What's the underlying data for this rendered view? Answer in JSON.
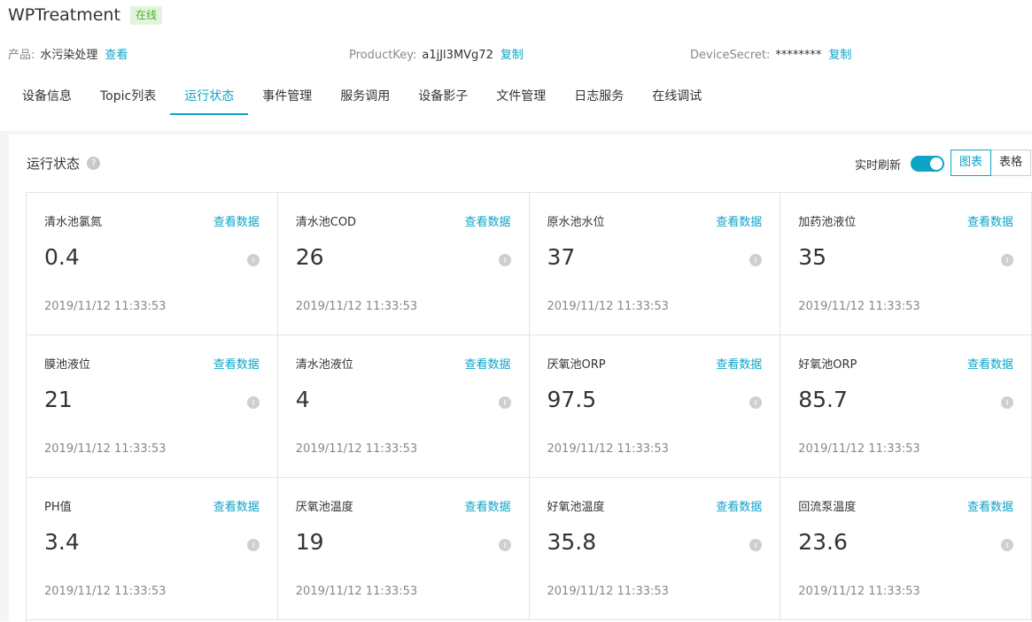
{
  "device": {
    "name": "WPTreatment",
    "status": "在线"
  },
  "meta": {
    "product_label": "产品:",
    "product_value": "水污染处理",
    "product_link": "查看",
    "productkey_label": "ProductKey:",
    "productkey_value": "a1jJl3MVg72",
    "productkey_copy": "复制",
    "secret_label": "DeviceSecret:",
    "secret_value": "********",
    "secret_copy": "复制"
  },
  "tabs": [
    {
      "label": "设备信息",
      "active": false
    },
    {
      "label": "Topic列表",
      "active": false
    },
    {
      "label": "运行状态",
      "active": true
    },
    {
      "label": "事件管理",
      "active": false
    },
    {
      "label": "服务调用",
      "active": false
    },
    {
      "label": "设备影子",
      "active": false
    },
    {
      "label": "文件管理",
      "active": false
    },
    {
      "label": "日志服务",
      "active": false
    },
    {
      "label": "在线调试",
      "active": false
    }
  ],
  "panel": {
    "title": "运行状态",
    "help_icon": "?",
    "refresh_label": "实时刷新",
    "refresh_on": true,
    "view_chart": "图表",
    "view_table": "表格",
    "view_active": "chart"
  },
  "card_link_label": "查看数据",
  "cards": [
    {
      "name": "清水池氯氮",
      "value": "0.4",
      "time": "2019/11/12 11:33:53"
    },
    {
      "name": "清水池COD",
      "value": "26",
      "time": "2019/11/12 11:33:53"
    },
    {
      "name": "原水池水位",
      "value": "37",
      "time": "2019/11/12 11:33:53"
    },
    {
      "name": "加药池液位",
      "value": "35",
      "time": "2019/11/12 11:33:53"
    },
    {
      "name": "膜池液位",
      "value": "21",
      "time": "2019/11/12 11:33:53"
    },
    {
      "name": "清水池液位",
      "value": "4",
      "time": "2019/11/12 11:33:53"
    },
    {
      "name": "厌氧池ORP",
      "value": "97.5",
      "time": "2019/11/12 11:33:53"
    },
    {
      "name": "好氧池ORP",
      "value": "85.7",
      "time": "2019/11/12 11:33:53"
    },
    {
      "name": "PH值",
      "value": "3.4",
      "time": "2019/11/12 11:33:53"
    },
    {
      "name": "厌氧池温度",
      "value": "19",
      "time": "2019/11/12 11:33:53"
    },
    {
      "name": "好氧池温度",
      "value": "35.8",
      "time": "2019/11/12 11:33:53"
    },
    {
      "name": "回流泵温度",
      "value": "23.6",
      "time": "2019/11/12 11:33:53"
    }
  ],
  "colors": {
    "accent": "#0ea4c8",
    "online_bg": "#e2f5dc",
    "online_text": "#48b12b"
  }
}
